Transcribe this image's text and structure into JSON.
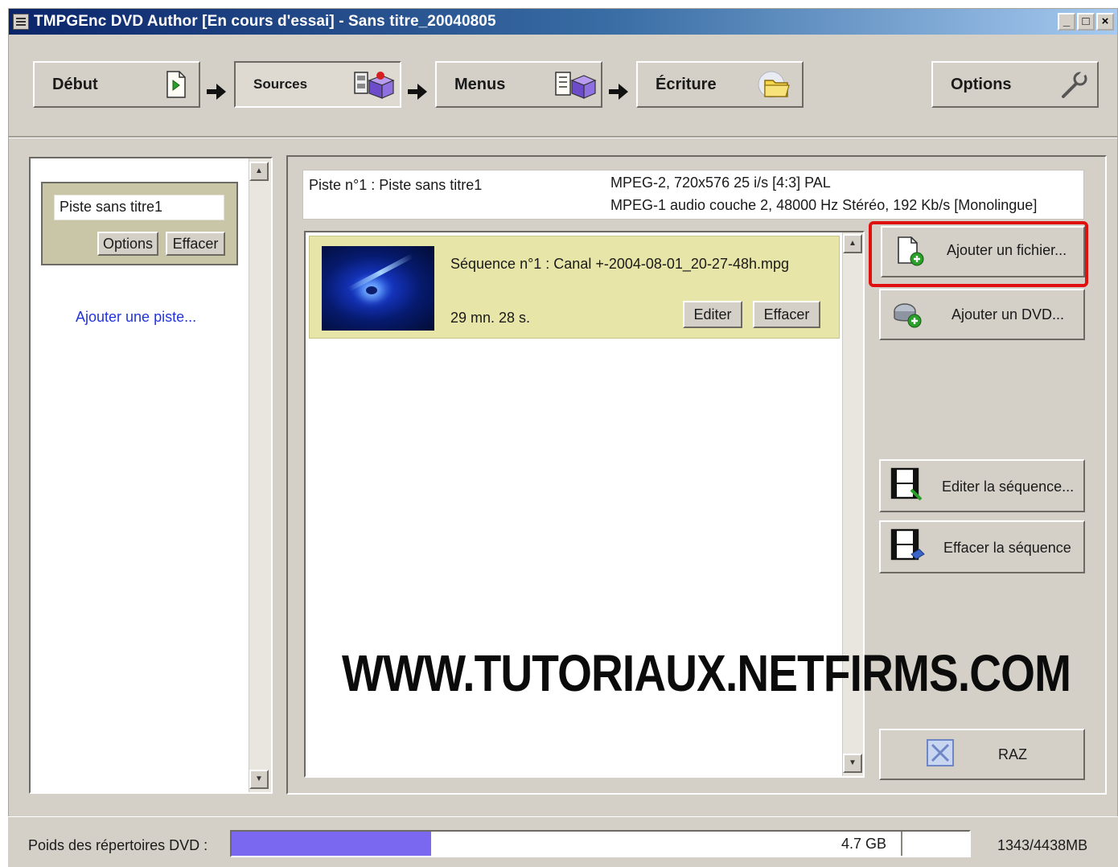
{
  "window": {
    "title": "TMPGEnc DVD Author [En cours d'essai] - Sans titre_20040805",
    "minimize": "_",
    "maximize": "□",
    "close": "×"
  },
  "steps": [
    {
      "label": "Début",
      "icon": "document-arrow-icon",
      "active": false
    },
    {
      "label": "Sources",
      "icon": "film-box-icon",
      "active": true
    },
    {
      "label": "Menus",
      "icon": "menu-box-icon",
      "active": false
    },
    {
      "label": "Écriture",
      "icon": "folder-disc-icon",
      "active": false
    }
  ],
  "options_button": {
    "label": "Options",
    "icon": "wrench-icon"
  },
  "tracks_panel": {
    "track_name": "Piste sans titre1",
    "options_label": "Options",
    "delete_label": "Effacer",
    "add_track_label": "Ajouter une piste..."
  },
  "track_info": {
    "title": "Piste n°1 : Piste sans titre1",
    "video": "MPEG-2, 720x576 25 i/s [4:3] PAL",
    "audio": "MPEG-1 audio couche 2, 48000 Hz Stéréo, 192 Kb/s [Monolingue]"
  },
  "sequences": [
    {
      "name": "Séquence n°1 : Canal +-2004-08-01_20-27-48h.mpg",
      "duration": "29 mn. 28 s.",
      "edit_label": "Editer",
      "delete_label": "Effacer"
    }
  ],
  "actions": {
    "add_file": "Ajouter un fichier...",
    "add_dvd": "Ajouter un DVD...",
    "edit_sequence": "Editer la séquence...",
    "delete_sequence": "Effacer la séquence",
    "reset": "RAZ"
  },
  "watermark": "WWW.TUTORIAUX.NETFIRMS.COM",
  "status": {
    "label": "Poids des répertoires DVD :",
    "capacity_label": "4.7 GB",
    "usage": "1343/4438MB",
    "fill_fraction": 0.27,
    "fill_color": "#7b68f0"
  },
  "colors": {
    "highlight": "#e01010",
    "sequence_bg": "#e7e5a8",
    "track_card_bg": "#c9c5a7",
    "link": "#2233dd"
  }
}
